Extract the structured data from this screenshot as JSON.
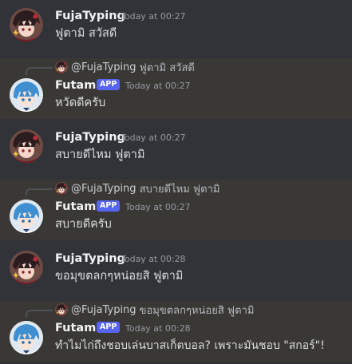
{
  "messages": [
    {
      "author": "FujaTyping",
      "timestamp": "Today at 00:27",
      "content": "ฟูตามิ สวัสดี",
      "avatar_icon": "dark-hair-anime-avatar"
    },
    {
      "author": "Futami",
      "badge": "APP",
      "timestamp": "Today at 00:27",
      "content": "หวัดดีครับ",
      "avatar_icon": "blue-hair-anime-avatar",
      "reply": {
        "mention": "@FujaTyping",
        "preview": "ฟูตามิ สวัสดี"
      }
    },
    {
      "author": "FujaTyping",
      "timestamp": "Today at 00:27",
      "content": "สบายดีไหม ฟูตามิ",
      "avatar_icon": "dark-hair-anime-avatar"
    },
    {
      "author": "Futami",
      "badge": "APP",
      "timestamp": "Today at 00:27",
      "content": "สบายดีครับ",
      "avatar_icon": "blue-hair-anime-avatar",
      "reply": {
        "mention": "@FujaTyping",
        "preview": "สบายดีไหม ฟูตามิ"
      }
    },
    {
      "author": "FujaTyping",
      "timestamp": "Today at 00:28",
      "content": "ขอมุขตลกๆหน่อยสิ ฟูตามิ",
      "avatar_icon": "dark-hair-anime-avatar"
    },
    {
      "author": "Futami",
      "badge": "APP",
      "timestamp": "Today at 00:28",
      "content": "ทำไมไก่ถึงชอบเล่นบาสเก็ตบอล? เพราะมันชอบ \"สกอร์\"!",
      "avatar_icon": "blue-hair-anime-avatar",
      "reply": {
        "mention": "@FujaTyping",
        "preview": "ขอมุขตลกๆหน่อยสิ ฟูตามิ"
      }
    }
  ],
  "colors": {
    "background": "#313338",
    "highlight": "#3a3834",
    "app_badge": "#5865f2"
  }
}
